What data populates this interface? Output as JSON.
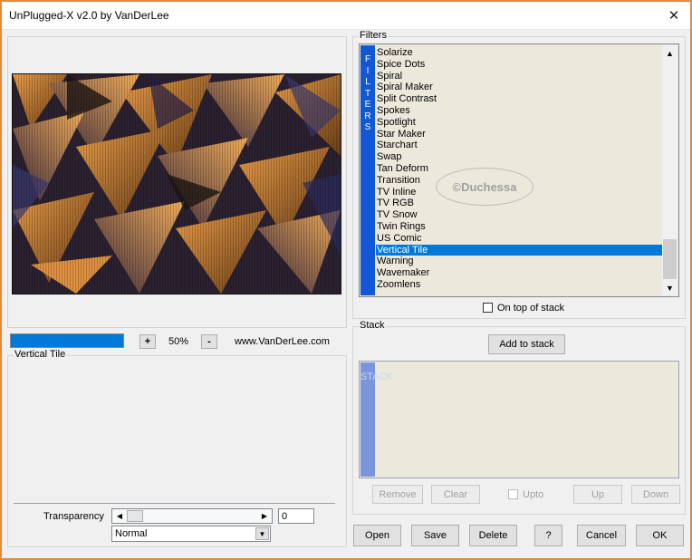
{
  "window": {
    "title": "UnPlugged-X v2.0 by VanDerLee"
  },
  "preview": {
    "zoom": "50%",
    "progress": 1.0,
    "website": "www.VanDerLee.com"
  },
  "current_filter": {
    "name": "Vertical Tile"
  },
  "controls": {
    "transparency_label": "Transparency",
    "transparency_value": "0",
    "blend_mode": "Normal"
  },
  "filters": {
    "group_label": "Filters",
    "strip_letters": [
      "F",
      "I",
      "L",
      "T",
      "E",
      "R",
      "S"
    ],
    "items": [
      "Solarize",
      "Spice Dots",
      "Spiral",
      "Spiral Maker",
      "Split Contrast",
      "Spokes",
      "Spotlight",
      "Star Maker",
      "Starchart",
      "Swap",
      "Tan Deform",
      "Transition",
      "TV Inline",
      "TV RGB",
      "TV Snow",
      "Twin Rings",
      "US Comic",
      "Vertical Tile",
      "Warning",
      "Wavemaker",
      "Zoomlens"
    ],
    "selected_index": 17,
    "on_top_label": "On top of stack",
    "watermark": "©Duchessa"
  },
  "stack": {
    "group_label": "Stack",
    "add_label": "Add to stack",
    "strip_letters": [
      "S",
      "T",
      "A",
      "C",
      "K"
    ],
    "remove_label": "Remove",
    "clear_label": "Clear",
    "upto_label": "Upto",
    "up_label": "Up",
    "down_label": "Down"
  },
  "footer": {
    "open": "Open",
    "save": "Save",
    "delete": "Delete",
    "help": "?",
    "cancel": "Cancel",
    "ok": "OK"
  },
  "icons": {
    "close": "close-icon",
    "plus": "plus-icon",
    "minus": "minus-icon",
    "arrow_up": "arrow-up-icon",
    "arrow_down": "arrow-down-icon",
    "arrow_left": "arrow-left-icon",
    "arrow_right": "arrow-right-icon"
  },
  "colors": {
    "accent": "#0078d7",
    "strip": "#1258d6",
    "stack_strip": "#7b95dd",
    "frame": "#e58a3a",
    "list_bg": "#ece9dc"
  }
}
